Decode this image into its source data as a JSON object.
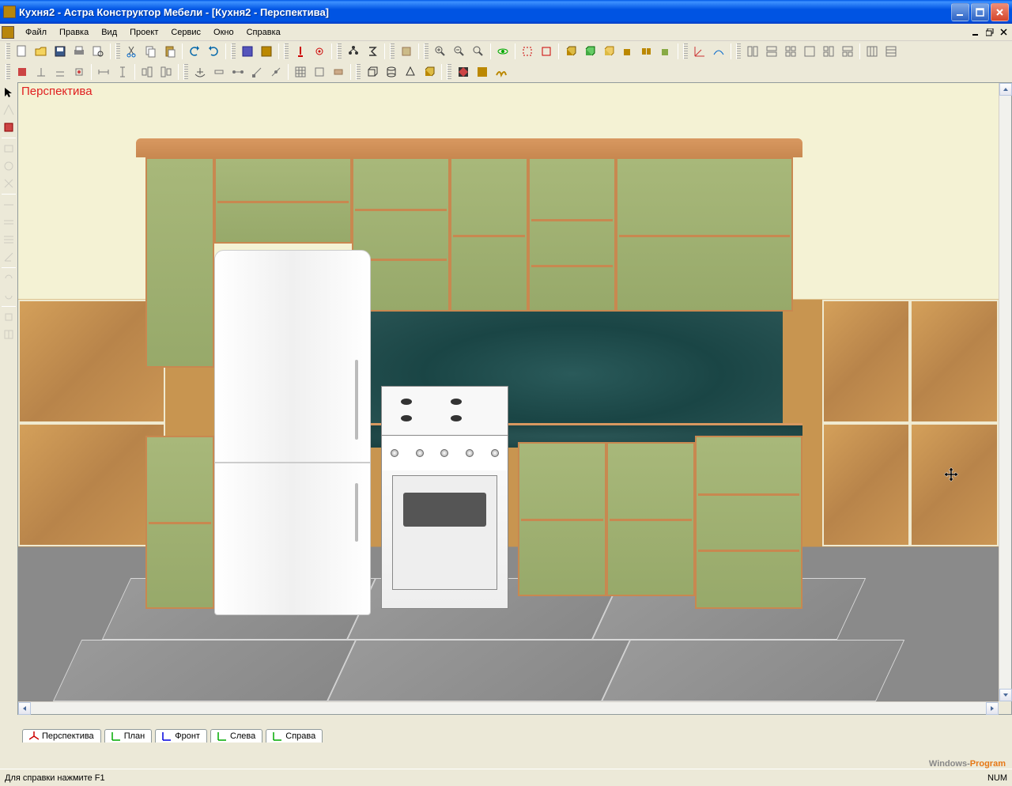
{
  "window": {
    "title": "Кухня2 - Астра Конструктор Мебели - [Кухня2 - Перспектива]"
  },
  "menu": {
    "items": [
      "Файл",
      "Правка",
      "Вид",
      "Проект",
      "Сервис",
      "Окно",
      "Справка"
    ]
  },
  "viewport": {
    "label": "Перспектива"
  },
  "view_tabs": [
    {
      "label": "Перспектива",
      "color": "#d00"
    },
    {
      "label": "План",
      "color": "#0a0"
    },
    {
      "label": "Фронт",
      "color": "#00d"
    },
    {
      "label": "Слева",
      "color": "#0a0"
    },
    {
      "label": "Справа",
      "color": "#0a0"
    }
  ],
  "statusbar": {
    "help": "Для справки нажмите F1",
    "num": "NUM"
  },
  "watermark": {
    "a": "Windows-",
    "b": "Program"
  }
}
